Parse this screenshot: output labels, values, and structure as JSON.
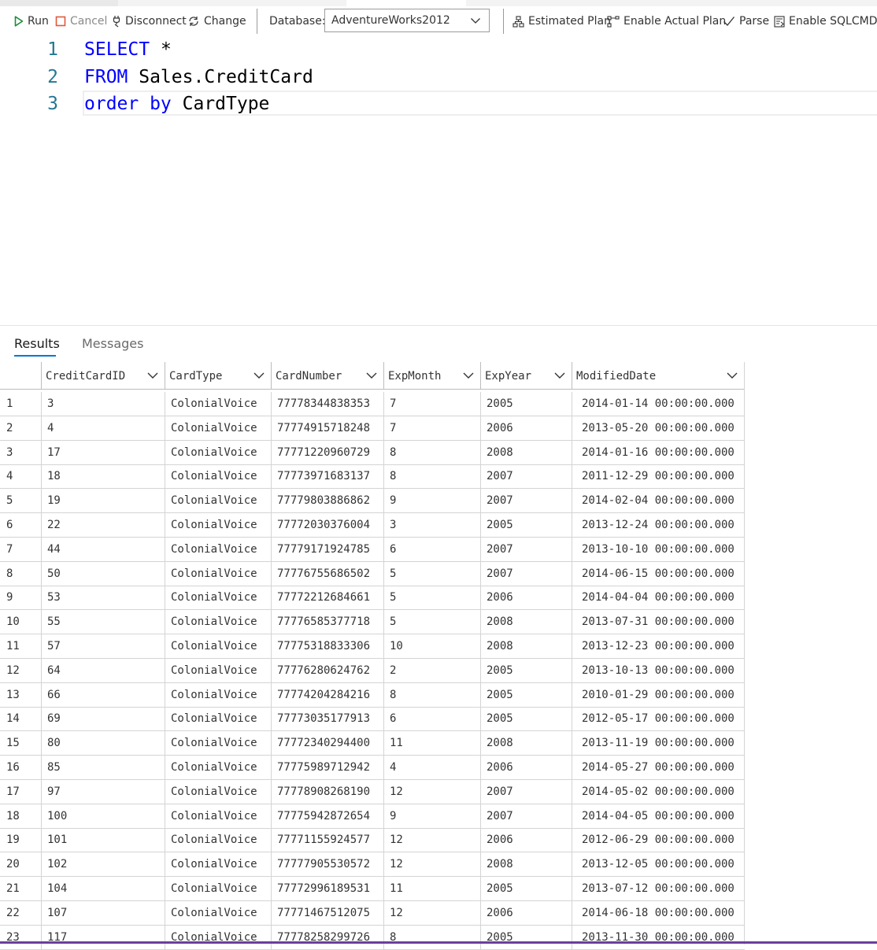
{
  "toolbar": {
    "run": "Run",
    "cancel": "Cancel",
    "disconnect": "Disconnect",
    "change": "Change",
    "database_label": "Database:",
    "database_value": "AdventureWorks2012",
    "estimated_plan": "Estimated Plan",
    "enable_actual_plan": "Enable Actual Plan",
    "parse": "Parse",
    "enable_sqlcmd": "Enable SQLCMD",
    "icons": [
      "play-icon",
      "stop-icon",
      "disconnect-icon",
      "change-connection-icon",
      "chevron-down-icon",
      "estimated-plan-icon",
      "actual-plan-icon",
      "checkmark-icon",
      "sqlcmd-icon"
    ],
    "colors": {
      "run_icon": "#1e8c3a",
      "cancel_icon": "#e0583a",
      "accent": "#0078d4"
    }
  },
  "editor": {
    "lines": [
      {
        "num": "1",
        "kw1": "SELECT",
        "rest": " *"
      },
      {
        "num": "2",
        "kw1": "FROM",
        "rest": " Sales.CreditCard"
      },
      {
        "num": "3",
        "kw1": "order by",
        "rest": " CardType"
      }
    ],
    "colors": {
      "keyword": "#0000ff",
      "line_number": "#237893"
    }
  },
  "results": {
    "tabs": [
      "Results",
      "Messages"
    ],
    "columns": [
      "CreditCardID",
      "CardType",
      "CardNumber",
      "ExpMonth",
      "ExpYear",
      "ModifiedDate"
    ],
    "rows": [
      [
        "1",
        "3",
        "ColonialVoice",
        "77778344838353",
        "7",
        "2005",
        "2014-01-14 00:00:00.000"
      ],
      [
        "2",
        "4",
        "ColonialVoice",
        "77774915718248",
        "7",
        "2006",
        "2013-05-20 00:00:00.000"
      ],
      [
        "3",
        "17",
        "ColonialVoice",
        "77771220960729",
        "8",
        "2008",
        "2014-01-16 00:00:00.000"
      ],
      [
        "4",
        "18",
        "ColonialVoice",
        "77773971683137",
        "8",
        "2007",
        "2011-12-29 00:00:00.000"
      ],
      [
        "5",
        "19",
        "ColonialVoice",
        "77779803886862",
        "9",
        "2007",
        "2014-02-04 00:00:00.000"
      ],
      [
        "6",
        "22",
        "ColonialVoice",
        "77772030376004",
        "3",
        "2005",
        "2013-12-24 00:00:00.000"
      ],
      [
        "7",
        "44",
        "ColonialVoice",
        "77779171924785",
        "6",
        "2007",
        "2013-10-10 00:00:00.000"
      ],
      [
        "8",
        "50",
        "ColonialVoice",
        "77776755686502",
        "5",
        "2007",
        "2014-06-15 00:00:00.000"
      ],
      [
        "9",
        "53",
        "ColonialVoice",
        "77772212684661",
        "5",
        "2006",
        "2014-04-04 00:00:00.000"
      ],
      [
        "10",
        "55",
        "ColonialVoice",
        "77776585377718",
        "5",
        "2008",
        "2013-07-31 00:00:00.000"
      ],
      [
        "11",
        "57",
        "ColonialVoice",
        "77775318833306",
        "10",
        "2008",
        "2013-12-23 00:00:00.000"
      ],
      [
        "12",
        "64",
        "ColonialVoice",
        "77776280624762",
        "2",
        "2005",
        "2013-10-13 00:00:00.000"
      ],
      [
        "13",
        "66",
        "ColonialVoice",
        "77774204284216",
        "8",
        "2005",
        "2010-01-29 00:00:00.000"
      ],
      [
        "14",
        "69",
        "ColonialVoice",
        "77773035177913",
        "6",
        "2005",
        "2012-05-17 00:00:00.000"
      ],
      [
        "15",
        "80",
        "ColonialVoice",
        "77772340294400",
        "11",
        "2008",
        "2013-11-19 00:00:00.000"
      ],
      [
        "16",
        "85",
        "ColonialVoice",
        "77775989712942",
        "4",
        "2006",
        "2014-05-27 00:00:00.000"
      ],
      [
        "17",
        "97",
        "ColonialVoice",
        "77778908268190",
        "12",
        "2007",
        "2014-05-02 00:00:00.000"
      ],
      [
        "18",
        "100",
        "ColonialVoice",
        "77775942872654",
        "9",
        "2007",
        "2014-04-05 00:00:00.000"
      ],
      [
        "19",
        "101",
        "ColonialVoice",
        "77771155924577",
        "12",
        "2006",
        "2012-06-29 00:00:00.000"
      ],
      [
        "20",
        "102",
        "ColonialVoice",
        "77777905530572",
        "12",
        "2008",
        "2013-12-05 00:00:00.000"
      ],
      [
        "21",
        "104",
        "ColonialVoice",
        "77772996189531",
        "11",
        "2005",
        "2013-07-12 00:00:00.000"
      ],
      [
        "22",
        "107",
        "ColonialVoice",
        "77771467512075",
        "12",
        "2006",
        "2014-06-18 00:00:00.000"
      ],
      [
        "23",
        "117",
        "ColonialVoice",
        "77778258299726",
        "8",
        "2005",
        "2013-11-30 00:00:00.000"
      ]
    ]
  }
}
